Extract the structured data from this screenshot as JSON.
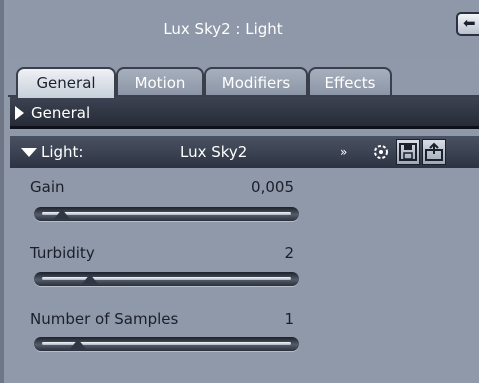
{
  "window": {
    "title": "Lux Sky2 : Light"
  },
  "tabs": [
    {
      "label": "General",
      "active": true
    },
    {
      "label": "Motion",
      "active": false
    },
    {
      "label": "Modifiers",
      "active": false
    },
    {
      "label": "Effects",
      "active": false
    }
  ],
  "group": {
    "label": "General"
  },
  "light": {
    "label": "Light:",
    "name": "Lux Sky2",
    "chevron": "»"
  },
  "params": [
    {
      "label": "Gain",
      "value": "0,005",
      "slider": 0.05
    },
    {
      "label": "Turbidity",
      "value": "2",
      "slider": 0.17
    },
    {
      "label": "Number of Samples",
      "value": "1",
      "slider": 0.12
    }
  ],
  "icons": [
    "pin-icon",
    "library-icon",
    "save-icon",
    "load-icon"
  ],
  "colors": {
    "panel": "#8f99a9",
    "header_bar": "#262b37",
    "text": "#1a1f2a"
  }
}
